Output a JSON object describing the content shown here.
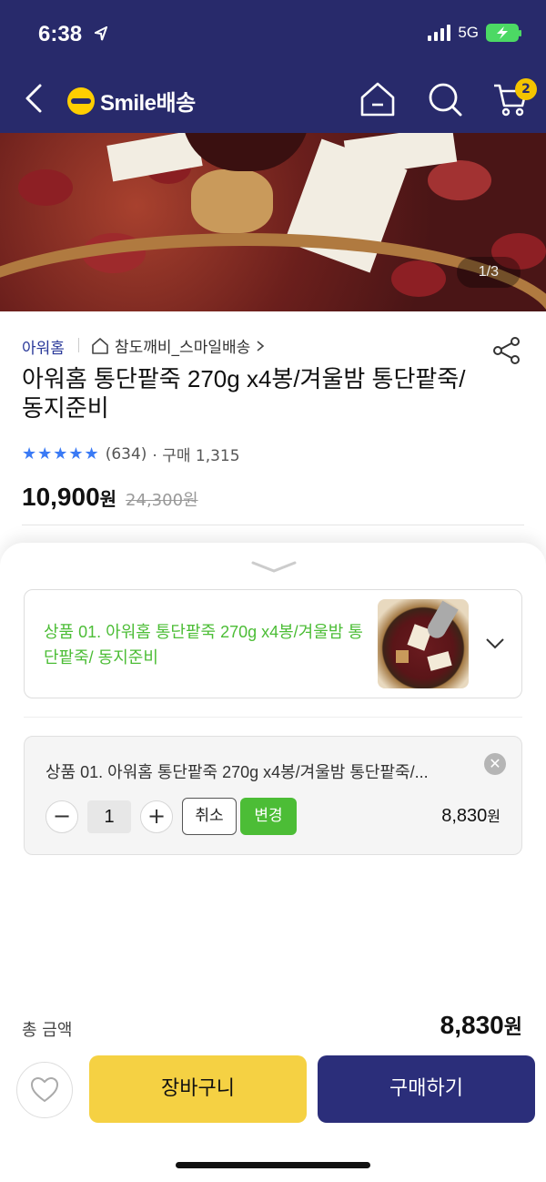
{
  "status_bar": {
    "time": "6:38",
    "network": "5G"
  },
  "header": {
    "logo_text": "Smile배송",
    "cart_count": "2"
  },
  "gallery": {
    "indicator": "1/3"
  },
  "product": {
    "brand": "아워홈",
    "store": "참도깨비_스마일배송",
    "title": "아워홈 통단팥죽 270g x4봉/겨울밤 통단팥죽/ 동지준비",
    "stars": "★★★★★",
    "review_count": "(634)",
    "purchase_count": "· 구매 1,315",
    "price": "10,900",
    "price_unit": "원",
    "original_price": "24,300원"
  },
  "option": {
    "selector_text": "상품 01. 아워홈 통단팥죽 270g x4봉/겨울밤 통단팥죽/ 동지준비",
    "selected_name": "상품 01. 아워홈 통단팥죽 270g x4봉/겨울밤 통단팥죽/...",
    "quantity": "1",
    "minus": "−",
    "plus": "+",
    "cancel_label": "취소",
    "change_label": "변경",
    "item_price": "8,830",
    "item_price_unit": "원"
  },
  "total": {
    "label": "총 금액",
    "amount": "8,830",
    "unit": "원"
  },
  "actions": {
    "cart_label": "장바구니",
    "buy_label": "구매하기"
  },
  "colors": {
    "navy": "#282a6b",
    "green": "#4cbd36",
    "yellow": "#f5d143",
    "star_blue": "#3a7af5"
  }
}
